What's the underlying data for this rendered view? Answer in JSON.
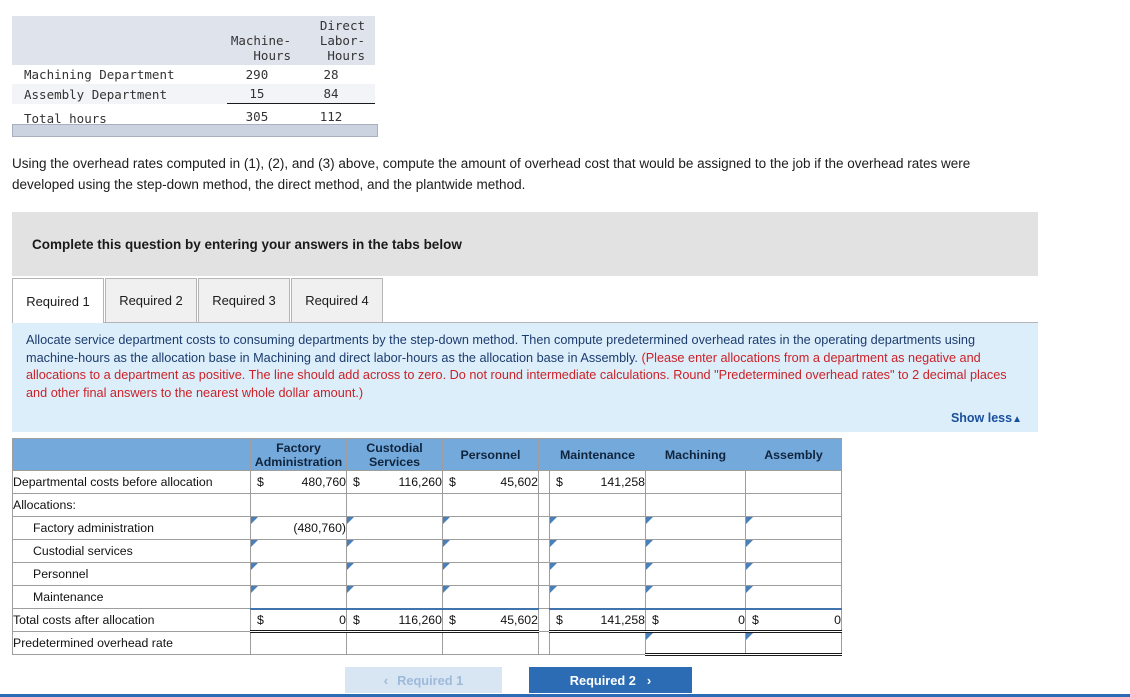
{
  "hours_table": {
    "columns": [
      "",
      "Machine-\nHours",
      "Direct\nLabor-\nHours"
    ],
    "rows": [
      {
        "label": "Machining Department",
        "machine_hours": "290",
        "direct_labor_hours": "28"
      },
      {
        "label": "Assembly Department",
        "machine_hours": "15",
        "direct_labor_hours": "84"
      }
    ],
    "total": {
      "label": "Total hours",
      "machine_hours": "305",
      "direct_labor_hours": "112"
    }
  },
  "narrative": "Using the overhead rates computed in (1), (2), and (3) above, compute the amount of overhead cost that would be assigned to the job if the overhead rates were developed using the step-down method, the direct method, and the plantwide method.",
  "banner": {
    "text": "Complete this question by entering your answers in the tabs below"
  },
  "tabs": [
    {
      "label": "Required 1",
      "active": true
    },
    {
      "label": "Required 2",
      "active": false
    },
    {
      "label": "Required 3",
      "active": false
    },
    {
      "label": "Required 4",
      "active": false
    }
  ],
  "instructions": {
    "black_part": "Allocate service department costs to consuming departments by the step-down method. Then compute predetermined overhead rates in the operating departments using machine-hours as the allocation base in Machining and direct labor-hours as the allocation base in Assembly.",
    "red_part": "(Please enter allocations from a department as negative and allocations to a department as positive. The line should add across to zero. Do not round intermediate calculations. Round \"Predetermined overhead rates\" to 2 decimal places and other final answers to the nearest whole dollar amount.)",
    "show_less_label": "Show less",
    "show_less_caret": "▲"
  },
  "grid": {
    "headers": {
      "blank": "",
      "factory_administration": "Factory\nAdministration",
      "custodial_services": "Custodial\nServices",
      "personnel": "Personnel",
      "maintenance": "Maintenance",
      "machining": "Machining",
      "assembly": "Assembly"
    },
    "rows": {
      "before_allocation": {
        "label": "Departmental costs before allocation",
        "factory_administration": {
          "currency": "$",
          "value": "480,760"
        },
        "custodial_services": {
          "currency": "$",
          "value": "116,260"
        },
        "personnel": {
          "currency": "$",
          "value": "45,602"
        },
        "maintenance": {
          "currency": "$",
          "value": "141,258"
        },
        "machining": {
          "currency": "",
          "value": ""
        },
        "assembly": {
          "currency": "",
          "value": ""
        }
      },
      "allocations_header": {
        "label": "Allocations:"
      },
      "factory_administration": {
        "label": "Factory administration",
        "factory_administration": "(480,760)",
        "custodial_services": "",
        "personnel": "",
        "maintenance": "",
        "machining": "",
        "assembly": ""
      },
      "custodial_services": {
        "label": "Custodial services",
        "factory_administration": "",
        "custodial_services": "",
        "personnel": "",
        "maintenance": "",
        "machining": "",
        "assembly": ""
      },
      "personnel": {
        "label": "Personnel",
        "factory_administration": "",
        "custodial_services": "",
        "personnel": "",
        "maintenance": "",
        "machining": "",
        "assembly": ""
      },
      "maintenance": {
        "label": "Maintenance",
        "factory_administration": "",
        "custodial_services": "",
        "personnel": "",
        "maintenance": "",
        "machining": "",
        "assembly": ""
      },
      "after_allocation": {
        "label": "Total costs after allocation",
        "factory_administration": {
          "currency": "$",
          "value": "0"
        },
        "custodial_services": {
          "currency": "$",
          "value": "116,260"
        },
        "personnel": {
          "currency": "$",
          "value": "45,602"
        },
        "maintenance": {
          "currency": "$",
          "value": "141,258"
        },
        "machining": {
          "currency": "$",
          "value": "0"
        },
        "assembly": {
          "currency": "$",
          "value": "0"
        }
      },
      "overhead_rate": {
        "label": "Predetermined overhead rate",
        "factory_administration": "",
        "custodial_services": "",
        "personnel": "",
        "maintenance": "",
        "machining": "",
        "assembly": ""
      }
    }
  },
  "nav": {
    "prev_label": "Required 1",
    "prev_arrow": "‹",
    "next_label": "Required 2",
    "next_arrow": "›"
  },
  "colors": {
    "header_blue": "#74a9db",
    "panel_blue": "#ddeefb",
    "red_text": "#cc2127",
    "link_blue": "#1a4f9c",
    "button_blue": "#2b6cb4"
  }
}
